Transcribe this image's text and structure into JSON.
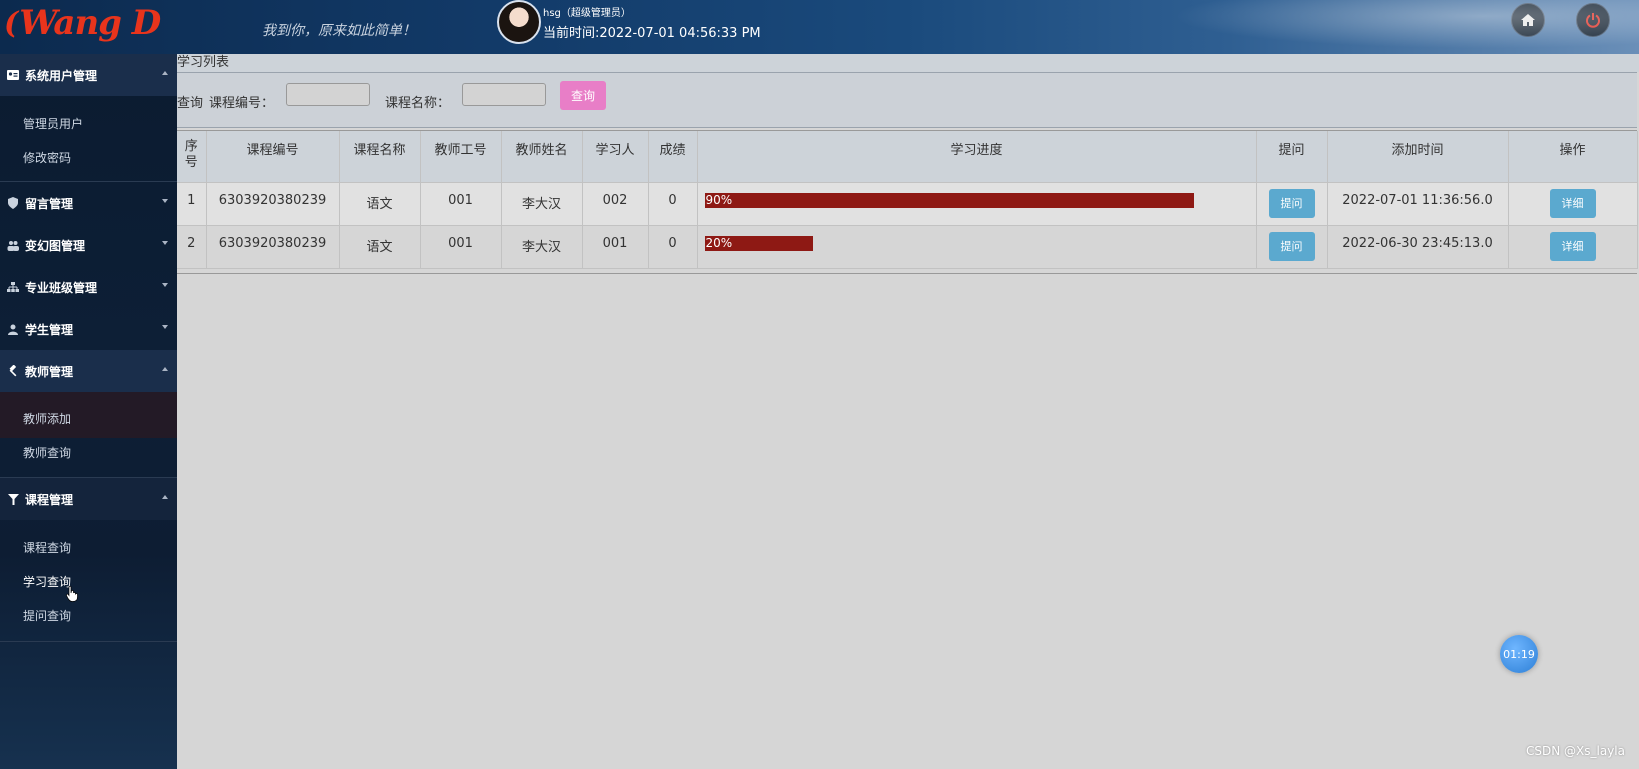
{
  "header": {
    "logo_text": "Wang D",
    "slogan": "我到你，原来如此简单！",
    "user": "hsg（超级管理员）",
    "current_time": "当前时间:2022-07-01 04:56:33 PM"
  },
  "sidebar": {
    "groups": [
      {
        "label": "系统用户管理",
        "icon": "id-card-icon",
        "open": true,
        "items": [
          "管理员用户",
          "修改密码"
        ]
      },
      {
        "label": "留言管理",
        "icon": "shield-icon",
        "open": false,
        "items": []
      },
      {
        "label": "变幻图管理",
        "icon": "users-icon",
        "open": false,
        "items": []
      },
      {
        "label": "专业班级管理",
        "icon": "sitemap-icon",
        "open": false,
        "items": []
      },
      {
        "label": "学生管理",
        "icon": "user-icon",
        "open": false,
        "items": []
      },
      {
        "label": "教师管理",
        "icon": "gavel-icon",
        "open": true,
        "items": [
          "教师添加",
          "教师查询"
        ]
      },
      {
        "label": "课程管理",
        "icon": "filter-icon",
        "open": true,
        "items": [
          "课程查询",
          "学习查询",
          "提问查询"
        ]
      }
    ]
  },
  "main": {
    "crumb": "学习列表",
    "search": {
      "prefix": "查询",
      "course_no_label": "课程编号：",
      "course_name_label": "课程名称：",
      "button": "查询"
    },
    "table": {
      "headers": [
        "序号",
        "课程编号",
        "课程名称",
        "教师工号",
        "教师姓名",
        "学习人",
        "成绩",
        "学习进度",
        "提问",
        "添加时间",
        "操作"
      ],
      "rows": [
        {
          "seq": "1",
          "course_no": "6303920380239",
          "course_name": "语文",
          "teacher_no": "001",
          "teacher_name": "李大汉",
          "learner": "002",
          "score": "0",
          "progress": 0.9,
          "progress_label": "90%",
          "ask": "提问",
          "added": "2022-07-01 11:36:56.0",
          "action": "详细"
        },
        {
          "seq": "2",
          "course_no": "6303920380239",
          "course_name": "语文",
          "teacher_no": "001",
          "teacher_name": "李大汉",
          "learner": "001",
          "score": "0",
          "progress": 0.2,
          "progress_label": "20%",
          "ask": "提问",
          "added": "2022-06-30 23:45:13.0",
          "action": "详细"
        }
      ]
    }
  },
  "timer": "01:19",
  "watermark": "CSDN @Xs_layla"
}
